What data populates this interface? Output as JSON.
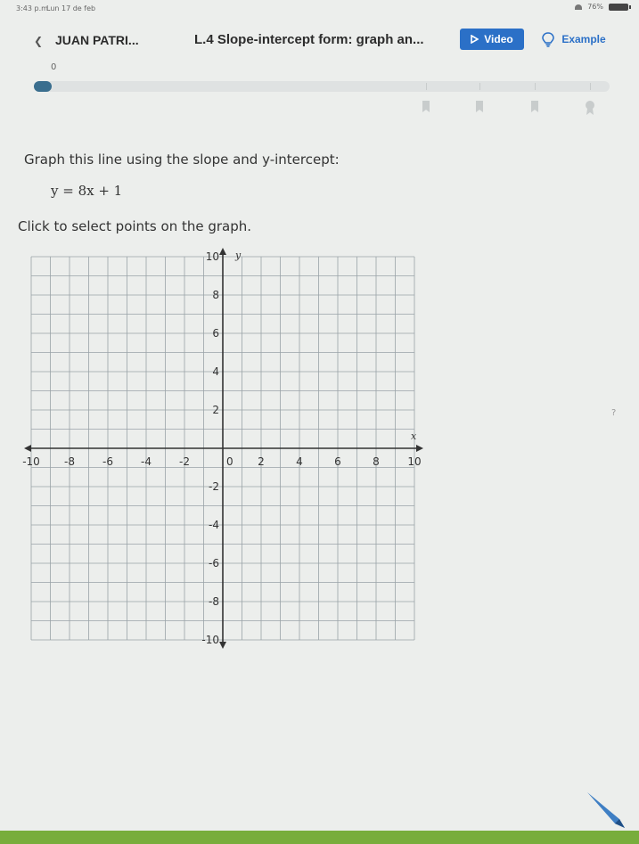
{
  "status_bar": {
    "time": "3:43 p.m.",
    "date": "Lun 17 de feb",
    "battery": "76%"
  },
  "header": {
    "back_icon": "chevron-left-icon",
    "student_name": "JUAN PATRI...",
    "lesson_title": "L.4 Slope-intercept form: graph an...",
    "video_label": "Video",
    "example_label": "Example"
  },
  "progress": {
    "value": 0,
    "fraction": 0.03,
    "award_icons": [
      "medal-icon",
      "medal-icon",
      "medal-icon",
      "trophy-icon"
    ]
  },
  "question": {
    "instruction": "Graph this line using the slope and y-intercept:",
    "equation": "y = 8x + 1",
    "click_instruction": "Click to select points on the graph."
  },
  "graph": {
    "x_label": "x",
    "y_label": "y",
    "x_tick_labels": [
      "-10",
      "-8",
      "-6",
      "-4",
      "-2",
      "0",
      "2",
      "4",
      "6",
      "8",
      "10"
    ],
    "y_tick_labels": [
      "10",
      "8",
      "6",
      "4",
      "2",
      "-2",
      "-4",
      "-6",
      "-8",
      "-10"
    ],
    "x_range": [
      -10,
      10
    ],
    "y_range": [
      -10,
      10
    ],
    "grid_step": 1,
    "grid_color": "#9aa2a8",
    "axis_color": "#333333"
  },
  "colors": {
    "accent": "#2b70c7",
    "progress_fill": "#3a6e8e",
    "bottom_strip": "#78ad3c",
    "background": "#eceeec"
  }
}
